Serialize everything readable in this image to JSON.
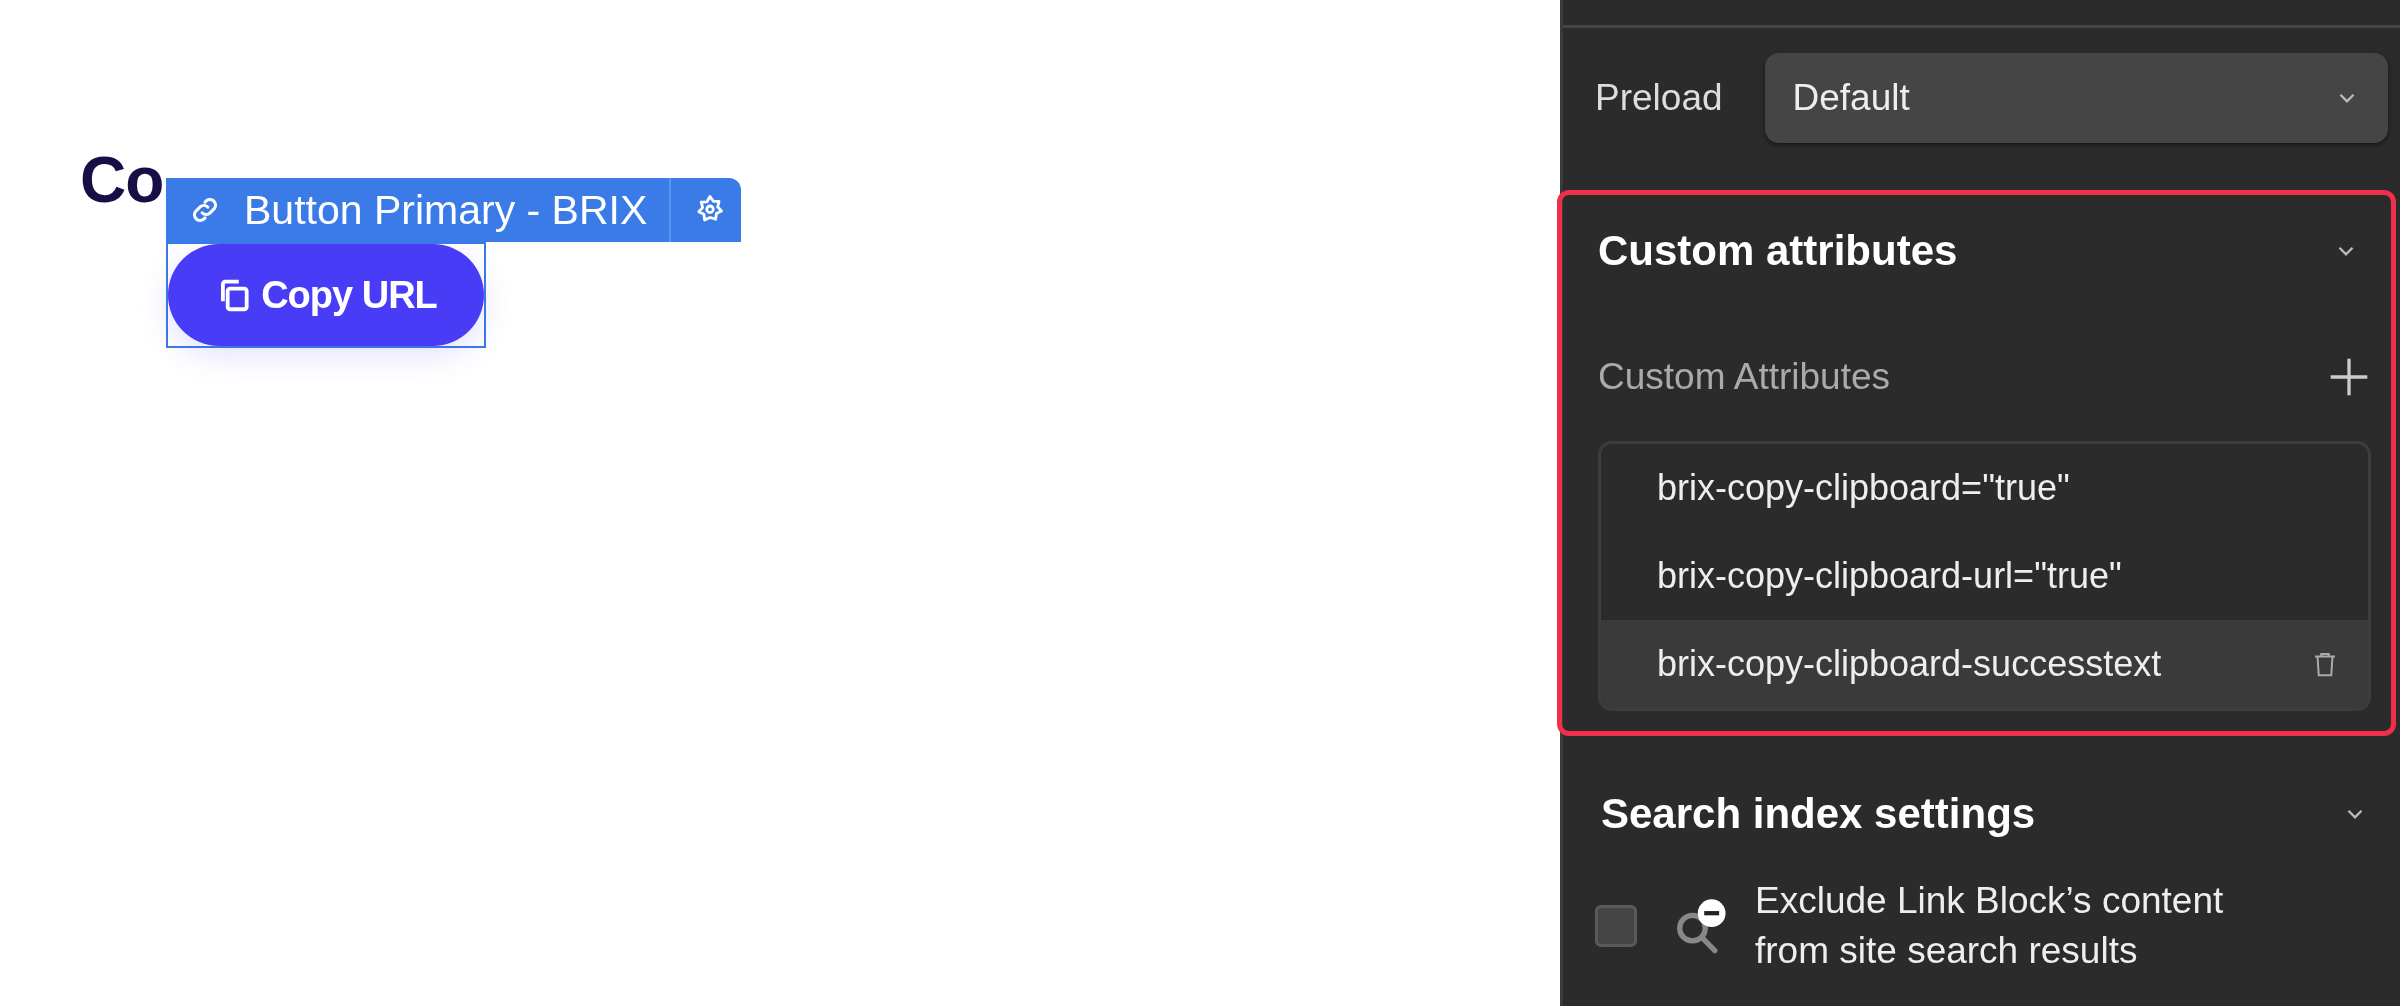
{
  "canvas": {
    "heading": "Co",
    "selection_label": {
      "text": "Button Primary - BRIX"
    },
    "button": {
      "label": "Copy URL"
    }
  },
  "panel": {
    "preload": {
      "label": "Preload",
      "value": "Default"
    },
    "custom_attributes": {
      "title": "Custom attributes",
      "expanded": true,
      "highlighted": true,
      "list_label": "Custom Attributes",
      "items": [
        {
          "text": "brix-copy-clipboard=\"true\"",
          "hovered": false
        },
        {
          "text": "brix-copy-clipboard-url=\"true\"",
          "hovered": false
        },
        {
          "text": "brix-copy-clipboard-successtext",
          "hovered": true
        }
      ]
    },
    "search_index": {
      "title": "Search index settings",
      "expanded": true,
      "option": {
        "label": "Exclude Link Block’s content from site search results",
        "checked": false
      }
    }
  }
}
